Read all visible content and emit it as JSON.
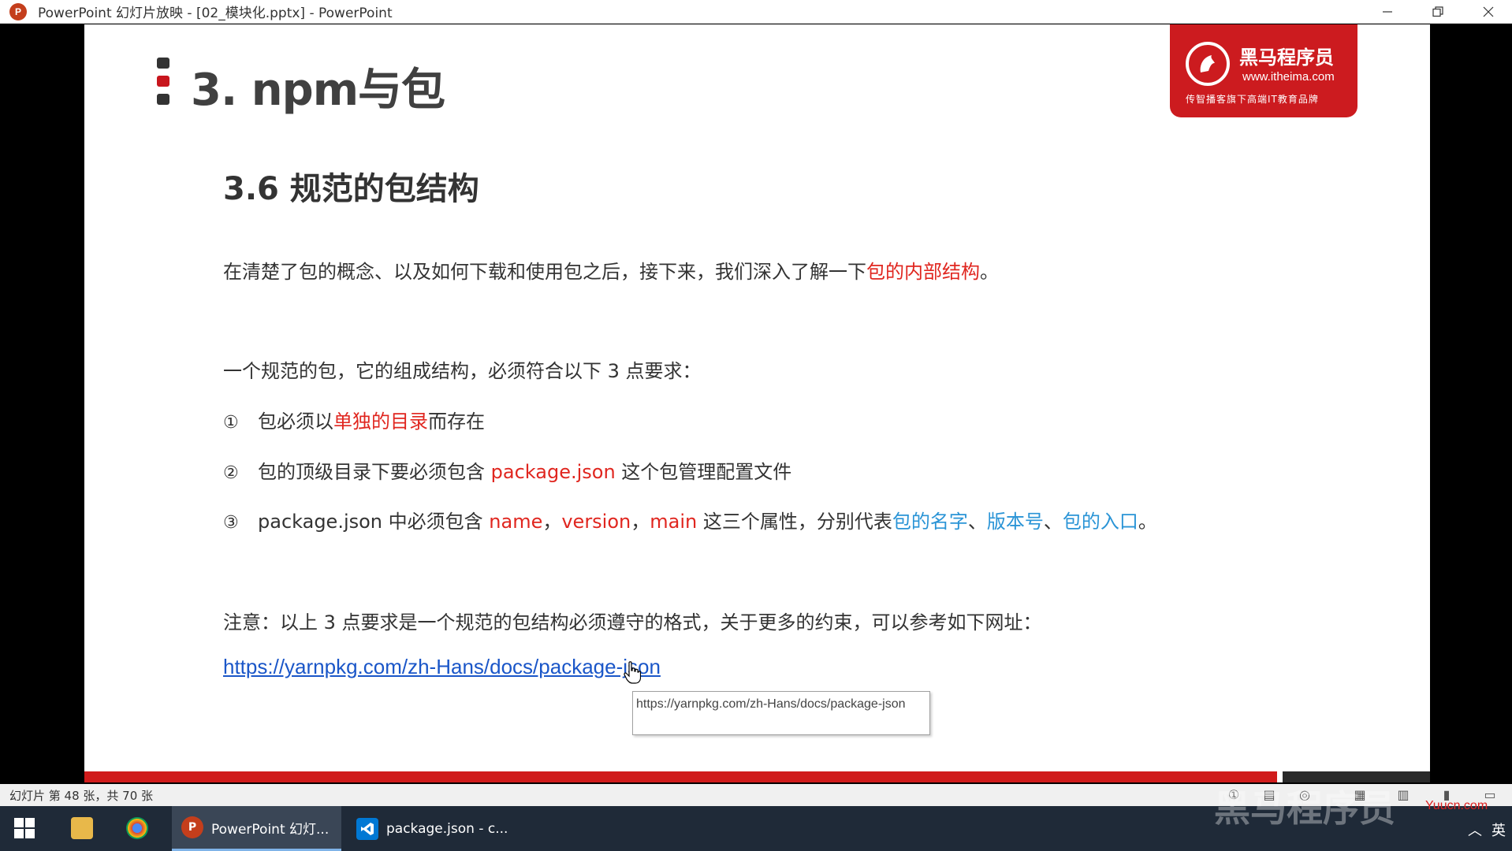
{
  "window": {
    "app_icon_letter": "P",
    "title": "PowerPoint 幻灯片放映 - [02_模块化.pptx] - PowerPoint",
    "minimize_icon": "minimize-icon",
    "restore_icon": "restore-icon",
    "close_icon": "close-icon"
  },
  "slide": {
    "title": "3. npm与包",
    "logo": {
      "brand": "黑马程序员",
      "site": "www.itheima.com",
      "slogan": "传智播客旗下高端IT教育品牌"
    },
    "section_title": "3.6 规范的包结构",
    "intro": {
      "before": "在清楚了包的概念、以及如何下载和使用包之后，接下来，我们深入了解一下",
      "highlight": "包的内部结构",
      "after": "。"
    },
    "requirements_intro": "一个规范的包，它的组成结构，必须符合以下 3 点要求：",
    "items": [
      {
        "num": "①",
        "before": "包必须以",
        "highlight": "单独的目录",
        "after": "而存在"
      },
      {
        "num": "②",
        "before": "包的顶级目录下要必须包含 ",
        "highlight": "package.json",
        "after": " 这个包管理配置文件"
      },
      {
        "num": "③",
        "before": "package.json 中必须包含 ",
        "red1": "name",
        "sep1": "，",
        "red2": "version",
        "sep2": "，",
        "red3": "main",
        "mid": " 这三个属性，分别代表",
        "blue1": "包的名字",
        "sep3": "、",
        "blue2": "版本号",
        "sep4": "、",
        "blue3": "包的入口",
        "end": "。"
      }
    ],
    "note": "注意：以上 3 点要求是一个规范的包结构必须遵守的格式，关于更多的约束，可以参考如下网址：",
    "link": "https://yarnpkg.com/zh-Hans/docs/package-json",
    "tooltip": "https://yarnpkg.com/zh-Hans/docs/package-json"
  },
  "statusbar": {
    "slide_count": "幻灯片 第 48 张，共 70 张"
  },
  "taskbar": {
    "apps": [
      {
        "label": "PowerPoint 幻灯...",
        "icon": "powerpoint-icon",
        "color": "#c43e1c",
        "letter": "P"
      },
      {
        "label": "package.json - c...",
        "icon": "vscode-icon",
        "color": "#0078d4",
        "letter": ""
      }
    ],
    "watermark": "黑马程序员",
    "site_mark": "Yuucn.com",
    "ime": "英"
  }
}
